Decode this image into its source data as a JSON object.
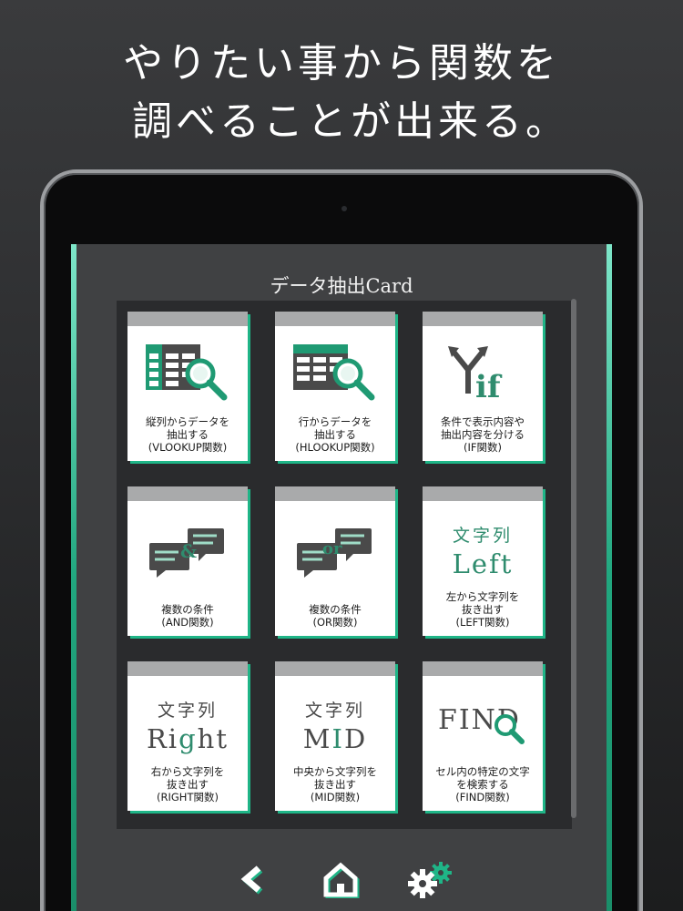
{
  "headline": {
    "line1": "やりたい事から関数を",
    "line2": "調べることが出来る。"
  },
  "screen": {
    "title": "データ抽出Card"
  },
  "cards": [
    {
      "icon": "table-search-column-icon",
      "label": "縦列からデータを\n抽出する\n(VLOOKUP関数)"
    },
    {
      "icon": "table-search-row-icon",
      "label": "行からデータを\n抽出する\n(HLOOKUP関数)"
    },
    {
      "icon": "branch-if-icon",
      "label": "条件で表示内容や\n抽出内容を分ける\n(IF関数)"
    },
    {
      "icon": "chat-and-icon",
      "label": "複数の条件\n(AND関数)"
    },
    {
      "icon": "chat-or-icon",
      "label": "複数の条件\n(OR関数)"
    },
    {
      "icon": "left-text-icon",
      "label": "左から文字列を\n抜き出す\n(LEFT関数)"
    },
    {
      "icon": "right-text-icon",
      "label": "右から文字列を\n抜き出す\n(RIGHT関数)"
    },
    {
      "icon": "mid-text-icon",
      "label": "中央から文字列を\n抜き出す\n(MID関数)"
    },
    {
      "icon": "find-search-icon",
      "label": "セル内の特定の文字\nを検索する\n(FIND関数)"
    }
  ],
  "icon_text": {
    "and_symbol": "&",
    "or_word": "or",
    "if_word": "if",
    "mojiretsu": "文字列",
    "left": "Left",
    "right_r": "Ri",
    "right_g": "g",
    "right_ht": "ht",
    "mid_m": "M",
    "mid_i": "I",
    "mid_d": "D",
    "find": "FIND"
  },
  "nav": {
    "back_icon": "chevron-left-icon",
    "home_icon": "home-icon",
    "settings_icon": "gears-icon"
  },
  "colors": {
    "accent": "#1fb587",
    "dark_green": "#2f8c6e",
    "icon_gray": "#4a4a4a"
  }
}
